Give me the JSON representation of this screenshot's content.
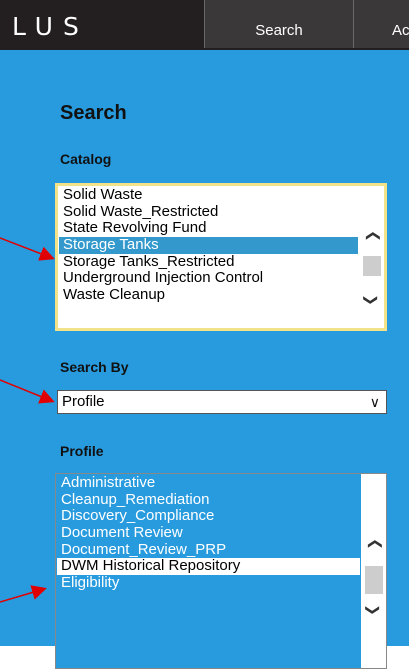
{
  "header": {
    "logo": "LUS",
    "tabs": [
      {
        "label": "Search"
      },
      {
        "label": "Ac"
      }
    ]
  },
  "panel": {
    "title": "Search",
    "catalog": {
      "label": "Catalog",
      "items": [
        "Solid Waste",
        "Solid Waste_Restricted",
        "State Revolving Fund",
        "Storage Tanks",
        "Storage Tanks_Restricted",
        "Underground Injection Control",
        "Waste Cleanup"
      ],
      "selected": "Storage Tanks"
    },
    "search_by": {
      "label": "Search By",
      "value": "Profile"
    },
    "profile": {
      "label": "Profile",
      "items": [
        "Administrative",
        "Cleanup_Remediation",
        "Discovery_Compliance",
        "Document Review",
        "Document_Review_PRP",
        "DWM Historical Repository",
        "Eligibility"
      ],
      "highlighted": "DWM Historical Repository"
    }
  },
  "colors": {
    "panel_bg": "#289bdf",
    "topbar_bg": "#231f20",
    "selection": "#3399cc",
    "annotation_arrow": "#e00000",
    "focus_border": "#f2e28a"
  },
  "icons": [
    "chevron-up-icon",
    "chevron-down-icon",
    "dropdown-caret-icon",
    "annotation-arrow-icon"
  ]
}
